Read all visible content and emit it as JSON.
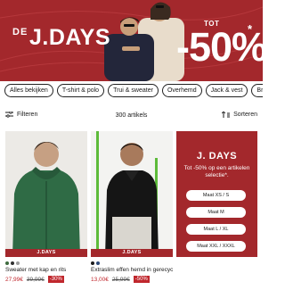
{
  "hero": {
    "prefix": "DE",
    "title": "J.DAYS",
    "tot": "TOT",
    "percent": "-50%",
    "asterisk": "*"
  },
  "filters": {
    "chips": [
      "Alles bekijken",
      "T-shirt & polo",
      "Trui & sweater",
      "Overhemd",
      "Jack & vest",
      "Broek & jeans"
    ]
  },
  "toolbar": {
    "filter_label": "Filteren",
    "count": "300 artikels",
    "sort_label": "Sorteren"
  },
  "products": [
    {
      "name": "Sweater met kap en rits",
      "price_now": "27,99€",
      "price_old": "39,99€",
      "discount": "-30%",
      "band": "J.DAYS",
      "swatches": [
        "#3e6b3e",
        "#2f2f2f",
        "#9b9b9b"
      ]
    },
    {
      "name": "Extraslim effen hemd in gerecycl...",
      "price_now": "13,00€",
      "price_old": "25,99€",
      "discount": "-50%",
      "band": "J.DAYS",
      "swatches": [
        "#1a1a1a",
        "#2e4a78"
      ]
    }
  ],
  "promo": {
    "title": "J. DAYS",
    "text": "Tot -50% op een artikelen selectie*.",
    "buttons": [
      "Maat XS / S",
      "Maat M",
      "Maat L / XL",
      "Maat XXL / XXXL"
    ]
  },
  "colors": {
    "brand_red": "#a3282c",
    "price_red": "#c0272d"
  }
}
